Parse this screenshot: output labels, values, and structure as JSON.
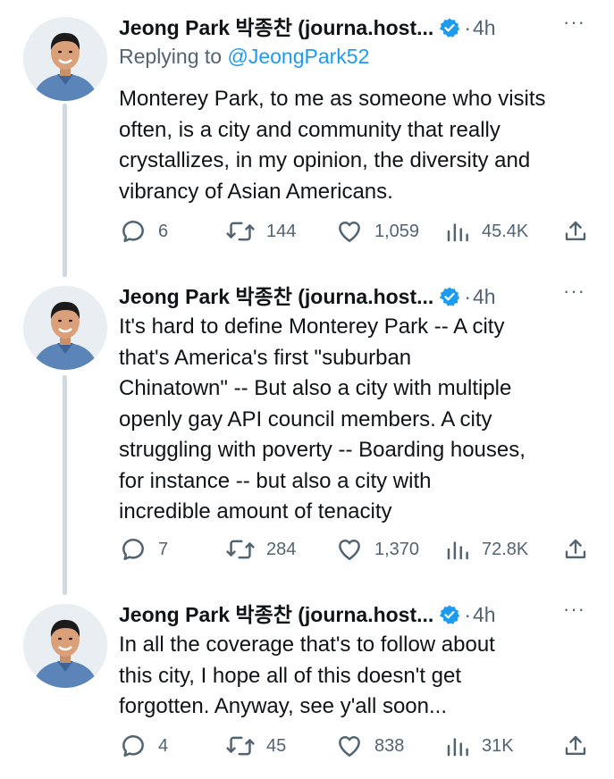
{
  "tweets": [
    {
      "author_name": "Jeong Park 박종찬 (journa.host...",
      "time": "4h",
      "dot": "·",
      "more": "···",
      "reply_prefix": "Replying to ",
      "reply_handle": "@JeongPark52",
      "text": "Monterey Park, to me as someone who visits\noften, is a city and community that really\ncrystallizes, in my opinion, the diversity and\nvibrancy of Asian Americans.",
      "stats": {
        "replies": "6",
        "retweets": "144",
        "likes": "1,059",
        "views": "45.4K"
      }
    },
    {
      "author_name": "Jeong Park 박종찬 (journa.host...",
      "time": "4h",
      "dot": "·",
      "more": "···",
      "text": "It's hard to define Monterey Park -- A city\nthat's America's first \"suburban\nChinatown\" -- But also a city with multiple\nopenly gay API council members. A city\nstruggling with poverty -- Boarding houses,\nfor instance -- but also a city with\nincredible amount of tenacity",
      "stats": {
        "replies": "7",
        "retweets": "284",
        "likes": "1,370",
        "views": "72.8K"
      }
    },
    {
      "author_name": "Jeong Park 박종찬 (journa.host...",
      "time": "4h",
      "dot": "·",
      "more": "···",
      "text": "In all the coverage that's to follow about\nthis city, I hope all of this doesn't get\nforgotten. Anyway, see y'all soon...",
      "stats": {
        "replies": "4",
        "retweets": "45",
        "likes": "838",
        "views": "31K"
      }
    }
  ],
  "colors": {
    "text": "#0f1419",
    "muted": "#536471",
    "link": "#1d9bf0",
    "verified": "#1d9bf0",
    "thread_line": "#cfd9de"
  }
}
